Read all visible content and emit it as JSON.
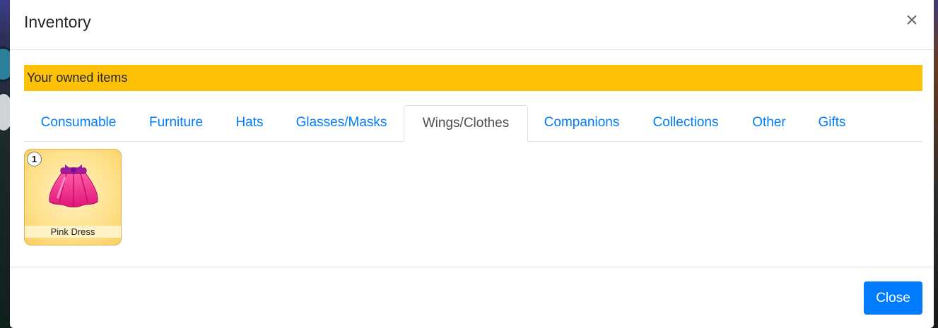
{
  "modal": {
    "title": "Inventory",
    "close_icon": "×"
  },
  "banner": {
    "text": "Your owned items",
    "color": "#ffc107"
  },
  "tabs": [
    {
      "label": "Consumable",
      "active": false
    },
    {
      "label": "Furniture",
      "active": false
    },
    {
      "label": "Hats",
      "active": false
    },
    {
      "label": "Glasses/Masks",
      "active": false
    },
    {
      "label": "Wings/Clothes",
      "active": true
    },
    {
      "label": "Companions",
      "active": false
    },
    {
      "label": "Collections",
      "active": false
    },
    {
      "label": "Other",
      "active": false
    },
    {
      "label": "Gifts",
      "active": false
    }
  ],
  "items": [
    {
      "name": "Pink Dress",
      "count": "1",
      "icon": "pink-dress-icon"
    }
  ],
  "footer": {
    "close_label": "Close"
  },
  "colors": {
    "accent": "#007bff",
    "banner": "#ffc107"
  }
}
